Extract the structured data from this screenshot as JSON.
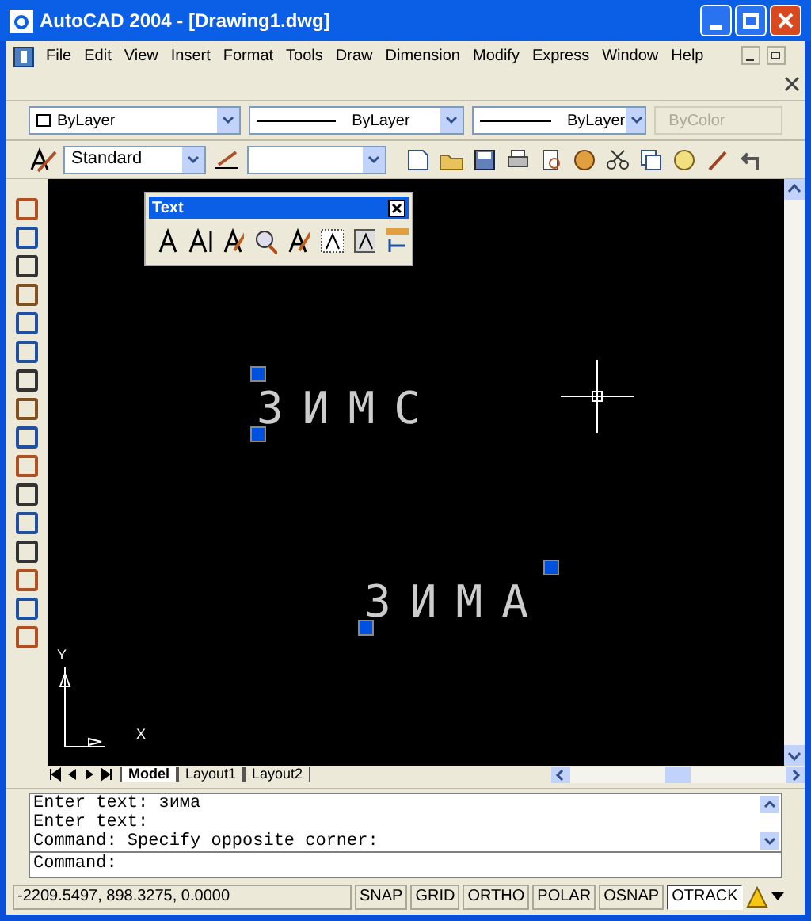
{
  "window": {
    "title": "AutoCAD 2004 - [Drawing1.dwg]"
  },
  "menu": [
    "File",
    "Edit",
    "View",
    "Insert",
    "Format",
    "Tools",
    "Draw",
    "Dimension",
    "Modify",
    "Express",
    "Window",
    "Help"
  ],
  "properties_toolbar": [
    {
      "kind": "layer",
      "value": "ByLayer"
    },
    {
      "kind": "line",
      "value": "ByLayer"
    },
    {
      "kind": "line",
      "value": "ByLayer"
    },
    {
      "kind": "disabled",
      "value": "ByColor"
    }
  ],
  "style_toolbar": {
    "text_style": "Standard"
  },
  "text_toolbar": {
    "title": "Text"
  },
  "drawing": {
    "texts": [
      {
        "text": "ЗИМС",
        "selected": true
      },
      {
        "text": "ЗИМА",
        "selected": true
      }
    ],
    "ucs": {
      "y": "Y",
      "x": "X"
    }
  },
  "layout_tabs": [
    {
      "label": "Model",
      "selected": true
    },
    {
      "label": "Layout1",
      "selected": false
    },
    {
      "label": "Layout2",
      "selected": false
    }
  ],
  "command_history": [
    "Enter text: зима",
    "Enter text:",
    "Command: Specify opposite corner:"
  ],
  "command_prompt": "Command:",
  "status_bar": {
    "coordinates": "-2209.5497, 898.3275, 0.0000",
    "toggles": [
      {
        "label": "SNAP",
        "on": false
      },
      {
        "label": "GRID",
        "on": false
      },
      {
        "label": "ORTHO",
        "on": false
      },
      {
        "label": "POLAR",
        "on": false
      },
      {
        "label": "OSNAP",
        "on": false
      },
      {
        "label": "OTRACK",
        "on": true
      }
    ]
  }
}
